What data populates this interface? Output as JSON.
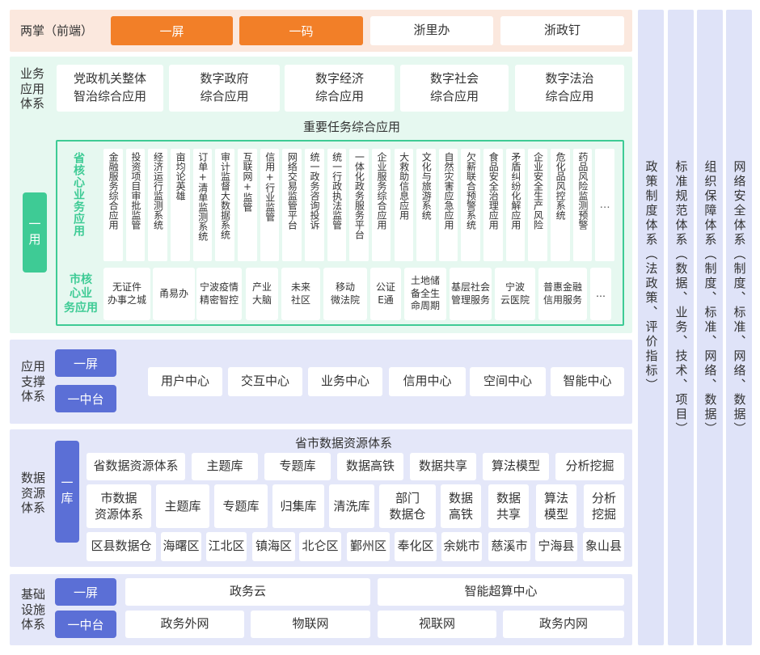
{
  "two_palm": {
    "label": "两掌（前端）",
    "items": [
      "一屏",
      "一码",
      "浙里办",
      "浙政钉"
    ]
  },
  "business": {
    "label": "业务\n应用\n体系",
    "top_apps": [
      "党政机关整体\n智治综合应用",
      "数字政府\n综合应用",
      "数字经济\n综合应用",
      "数字社会\n综合应用",
      "数字法治\n综合应用"
    ],
    "key_title": "重要任务综合应用",
    "yiyong": "一用",
    "prov_label": "省核心业务应用",
    "prov_items": [
      "金融服务综合应用",
      "投资项目审批监管",
      "经济运行监测系统",
      "亩均论英雄",
      "订单+清单监测系统",
      "审计监督大数据系统",
      "互联网+监管",
      "信用+行业监管",
      "网络交易监管平台",
      "统一政务咨询投诉",
      "统一行政执法监管",
      "一体化政务服务平台",
      "企业服务综合应用",
      "大救助信息应用",
      "文化与旅游系统",
      "自然灾害应急应用",
      "欠薪联合预警系统",
      "食品安全治理应用",
      "矛盾纠纷化解应用",
      "企业安全生产风险",
      "危化品风控系统",
      "药品风险监测预警",
      "…"
    ],
    "city_label": "市核\n心业\n务应用",
    "city_items": [
      "无证件\n办事之城",
      "甬易办",
      "宁波疫情\n精密智控",
      "产业\n大脑",
      "未来\n社区",
      "移动\n微法院",
      "公证\nE通",
      "土地储\n备全生\n命周期",
      "基层社会\n管理服务",
      "宁波\n云医院",
      "普惠金融\n信用服务",
      "…"
    ]
  },
  "support": {
    "label": "应用\n支撑\n体系",
    "left_buttons": [
      "一屏",
      "一中台"
    ],
    "centers": [
      "用户中心",
      "交互中心",
      "业务中心",
      "信用中心",
      "空间中心",
      "智能中心"
    ]
  },
  "data_res": {
    "label": "数据\n资源\n体系",
    "yiku": "一库",
    "title": "省市数据资源体系",
    "row1": [
      "省数据资源体系",
      "主题库",
      "专题库",
      "数据高铁",
      "数据共享",
      "算法模型",
      "分析挖掘"
    ],
    "row2": [
      "市数据\n资源体系",
      "主题库",
      "专题库",
      "归集库",
      "清洗库",
      "部门\n数据仓",
      "数据\n高铁",
      "数据\n共享",
      "算法\n模型",
      "分析\n挖掘"
    ],
    "row3": [
      "区县数据仓",
      "海曙区",
      "江北区",
      "镇海区",
      "北仑区",
      "鄞州区",
      "奉化区",
      "余姚市",
      "慈溪市",
      "宁海县",
      "象山县"
    ]
  },
  "infra": {
    "label": "基础\n设施\n体系",
    "left_buttons": [
      "一屏",
      "一中台"
    ],
    "row1": [
      "政务云",
      "智能超算中心"
    ],
    "row2": [
      "政务外网",
      "物联网",
      "视联网",
      "政务内网"
    ]
  },
  "right_cols": [
    "政策制度体系（法政策、评价指标）",
    "标准规范体系（数据、业务、技术、项目）",
    "组织保障体系（制度、标准、网络、数据）",
    "网络安全体系（制度、标准、网络、数据）"
  ],
  "colors": {
    "orange": "#f27f28",
    "blue": "#5b6fd6",
    "green": "#3ecb95",
    "mint_bg": "#e6f8f0",
    "lavender_bg": "#e4e7f9",
    "orange_bg": "#fbe8de"
  }
}
